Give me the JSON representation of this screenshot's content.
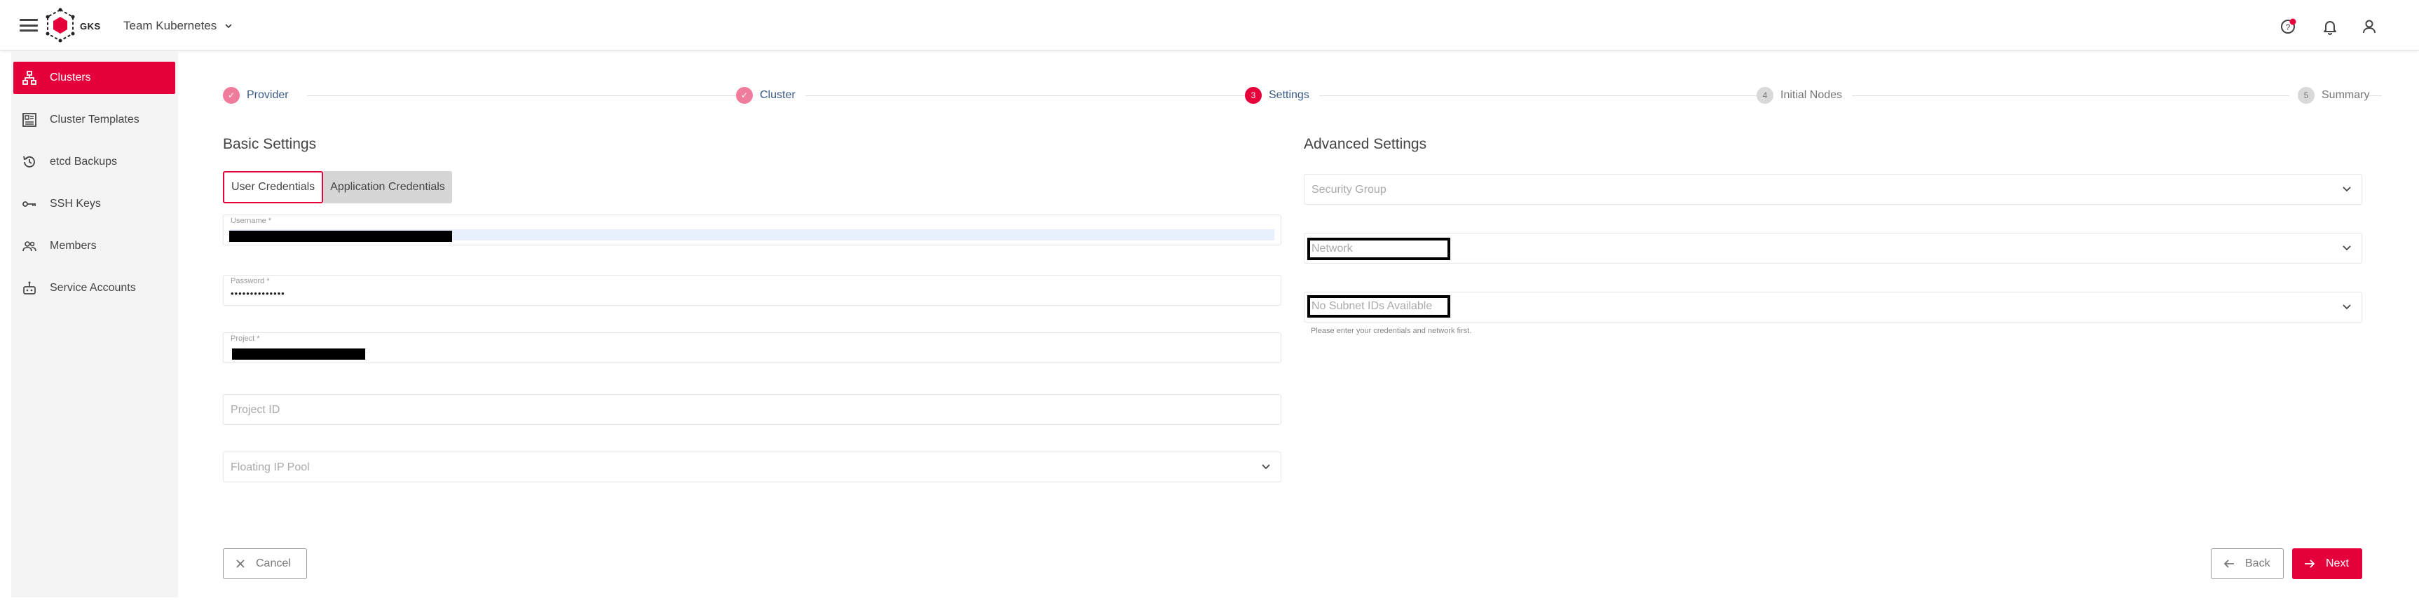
{
  "header": {
    "logo_text": "GKS",
    "project_name": "Team Kubernetes"
  },
  "sidebar": {
    "items": [
      {
        "label": "Clusters",
        "icon": "sitemap-icon",
        "active": true
      },
      {
        "label": "Cluster Templates",
        "icon": "template-icon",
        "active": false
      },
      {
        "label": "etcd Backups",
        "icon": "history-icon",
        "active": false
      },
      {
        "label": "SSH Keys",
        "icon": "key-icon",
        "active": false
      },
      {
        "label": "Members",
        "icon": "members-icon",
        "active": false
      },
      {
        "label": "Service Accounts",
        "icon": "robot-icon",
        "active": false
      }
    ]
  },
  "stepper": {
    "steps": [
      {
        "label": "Provider",
        "marker": "✓",
        "state": "done"
      },
      {
        "label": "Cluster",
        "marker": "✓",
        "state": "done"
      },
      {
        "label": "Settings",
        "marker": "3",
        "state": "active"
      },
      {
        "label": "Initial Nodes",
        "marker": "4",
        "state": "pending"
      },
      {
        "label": "Summary",
        "marker": "5",
        "state": "pending"
      }
    ]
  },
  "basic": {
    "title": "Basic Settings",
    "tabs": {
      "user": "User Credentials",
      "application": "Application Credentials"
    },
    "username_label": "Username *",
    "password_label": "Password *",
    "password_value": "••••••••••••••",
    "project_label": "Project *",
    "project_id_placeholder": "Project ID",
    "floating_ip_placeholder": "Floating IP Pool"
  },
  "advanced": {
    "title": "Advanced Settings",
    "security_group_placeholder": "Security Group",
    "network_placeholder": "Network",
    "subnet_placeholder": "No Subnet IDs Available",
    "subnet_hint": "Please enter your credentials and network first."
  },
  "actions": {
    "cancel": "Cancel",
    "back": "Back",
    "next": "Next"
  },
  "colors": {
    "accent": "#e5003c",
    "step_done": "#ef7c9b",
    "step_label": "#3c5a88"
  }
}
